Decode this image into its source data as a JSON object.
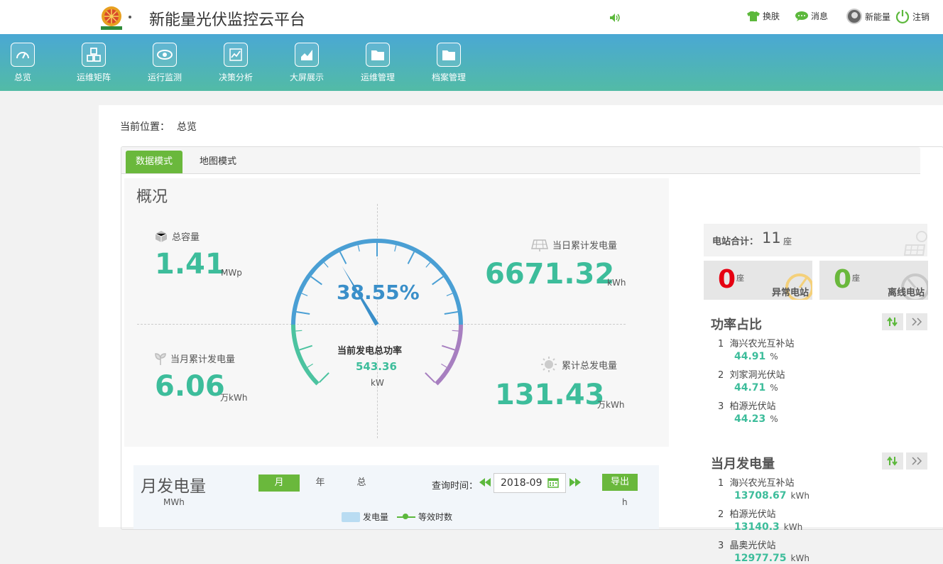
{
  "app": {
    "title": "新能量光伏监控云平台"
  },
  "topbar": {
    "skin_label": "换肤",
    "message_label": "消息",
    "user_name": "新能量",
    "logout_label": "注销"
  },
  "nav": {
    "items": [
      {
        "label": "总览",
        "icon": "gauge-icon"
      },
      {
        "label": "运维矩阵",
        "icon": "cubes-icon"
      },
      {
        "label": "运行监测",
        "icon": "eye-icon"
      },
      {
        "label": "决策分析",
        "icon": "chart-icon"
      },
      {
        "label": "大屏展示",
        "icon": "area-chart-icon"
      },
      {
        "label": "运维管理",
        "icon": "folder-icon"
      },
      {
        "label": "档案管理",
        "icon": "folder-icon"
      }
    ]
  },
  "breadcrumb": {
    "prefix": "当前位置：",
    "current": "总览"
  },
  "tabs": {
    "data_mode": "数据模式",
    "map_mode": "地图模式"
  },
  "overview": {
    "title": "概况",
    "total_capacity": {
      "label": "总容量",
      "value": "1.41",
      "unit": "MWp"
    },
    "daily_energy": {
      "label": "当日累计发电量",
      "value": "6671.32",
      "unit": "kWh"
    },
    "monthly_energy": {
      "label": "当月累计发电量",
      "value": "6.06",
      "unit": "万kWh"
    },
    "total_energy": {
      "label": "累计总发电量",
      "value": "131.43",
      "unit": "万kWh"
    },
    "gauge": {
      "percent_text": "38.55%",
      "percent": 38.55,
      "label": "当前发电总功率",
      "value": "543.36",
      "unit": "kW"
    }
  },
  "monthly": {
    "title": "月发电量",
    "unit_left": "MWh",
    "unit_right": "h",
    "period_month": "月",
    "period_year": "年",
    "period_total": "总",
    "query_label": "查询时间：",
    "date_value": "2018-09",
    "export_label": "导出",
    "legend_bar": "发电量",
    "legend_line": "等效时数"
  },
  "stations": {
    "total_label": "电站合计：",
    "total_value": "11",
    "total_unit": "座",
    "abnormal": {
      "value": "0",
      "unit": "座",
      "label": "异常电站",
      "color": "#e60012"
    },
    "offline": {
      "value": "0",
      "unit": "座",
      "label": "离线电站",
      "color": "#6ab83c"
    }
  },
  "power_ratio": {
    "title": "功率占比",
    "items": [
      {
        "rank": "1",
        "name": "海兴农光互补站",
        "value": "44.91",
        "unit": "%"
      },
      {
        "rank": "2",
        "name": "刘家洞光伏站",
        "value": "44.71",
        "unit": "%"
      },
      {
        "rank": "3",
        "name": "柏源光伏站",
        "value": "44.23",
        "unit": "%"
      }
    ]
  },
  "monthly_generation": {
    "title": "当月发电量",
    "items": [
      {
        "rank": "1",
        "name": "海兴农光互补站",
        "value": "13708.67",
        "unit": "kWh"
      },
      {
        "rank": "2",
        "name": "柏源光伏站",
        "value": "13140.3",
        "unit": "kWh"
      },
      {
        "rank": "3",
        "name": "晶奥光伏站",
        "value": "12977.75",
        "unit": "kWh"
      }
    ]
  }
}
